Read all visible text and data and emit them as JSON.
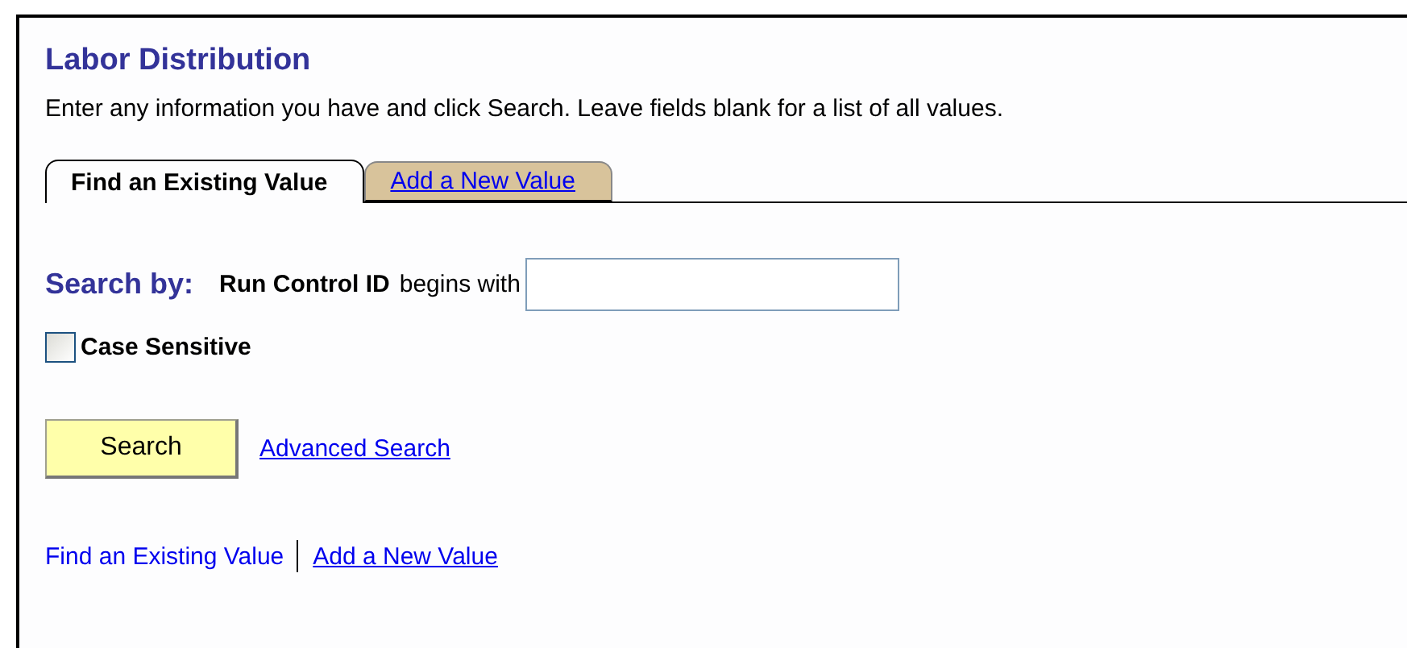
{
  "title": "Labor Distribution",
  "instructions": "Enter any information you have and click Search. Leave fields blank for a list of all values.",
  "tabs": [
    {
      "label": "Find an Existing Value",
      "selected": true
    },
    {
      "label": "Add a New Value",
      "selected": false
    }
  ],
  "search_by": {
    "heading": "Search by:",
    "field_label": "Run Control ID",
    "operator": "begins with"
  },
  "case_sensitive": {
    "label": "Case Sensitive",
    "checked": false
  },
  "search_button": "Search",
  "advanced_search_link": "Advanced Search",
  "bottom_links": [
    {
      "label": "Find an Existing Value",
      "selected": true
    },
    {
      "label": "Add a New Value",
      "selected": false
    }
  ]
}
